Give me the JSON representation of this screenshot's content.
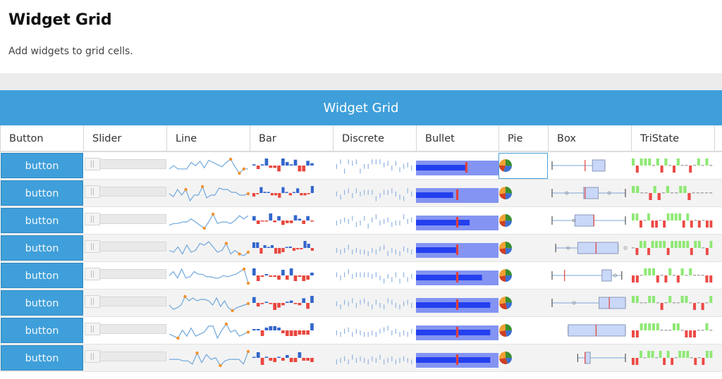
{
  "page": {
    "title": "Widget Grid",
    "subtitle": "Add widgets to grid cells."
  },
  "grid": {
    "title": "Widget Grid",
    "columns": [
      "Button",
      "Slider",
      "Line",
      "Bar",
      "Discrete",
      "Bullet",
      "Pie",
      "Box",
      "TriState"
    ],
    "colors": {
      "header_bg": "#3f9fda",
      "line": "#6fa8dc",
      "line_marker": "#f0922e",
      "bar_pos": "#3366cc",
      "bar_neg": "#e8473e",
      "discrete": "#8fb4e0",
      "bullet_range": "#8494f2",
      "bullet_value": "#2440ee",
      "bullet_target": "#e2403a",
      "pie": [
        "#3a8f2e",
        "#3c6fd4",
        "#cf3f22",
        "#f2a134"
      ],
      "box_fill": "#c9d7f8",
      "box_median": "#e2403a",
      "tristate_pos": "#8ee874",
      "tristate_neg": "#ec4a45",
      "tristate_zero": "#aaaaaa"
    },
    "rows": [
      {
        "button_label": "button",
        "slider_value": 0,
        "line": [
          6,
          9,
          6,
          6,
          6,
          12,
          9,
          13,
          7,
          14,
          12,
          10,
          8,
          12,
          15,
          8,
          2,
          6,
          6
        ],
        "line_markers": [
          14,
          16,
          17
        ],
        "bar": [
          1,
          -3,
          1,
          6,
          -2,
          -2,
          -5,
          6,
          3,
          1,
          5,
          -5,
          -5,
          4,
          2
        ],
        "discrete": [
          6,
          9,
          3,
          9,
          8,
          9,
          3,
          6,
          6,
          9,
          9,
          9,
          7,
          8,
          5,
          8,
          4,
          6,
          7,
          5
        ],
        "bullet": {
          "value": 0.6,
          "target": 0.61
        },
        "pie": [
          0.27,
          0.28,
          0.2,
          0.25
        ],
        "box": {
          "min": 0.0,
          "q1": 0.55,
          "median": 0.45,
          "q3": 0.72,
          "max": 0.72,
          "outliers": []
        },
        "tristate": [
          1,
          -1,
          1,
          1,
          1,
          0,
          1,
          -1,
          1,
          0,
          -1,
          1,
          0,
          0,
          -1,
          0,
          1,
          0,
          1,
          0
        ]
      },
      {
        "button_label": "button",
        "slider_value": 0,
        "line": [
          7,
          5,
          10,
          6,
          10,
          2,
          6,
          6,
          12,
          4,
          6,
          6,
          11,
          10,
          10,
          8,
          8,
          6,
          6,
          7
        ],
        "line_markers": [
          4,
          8,
          19
        ],
        "bar": [
          -3,
          -1,
          5,
          1,
          0,
          -2,
          -2,
          -4,
          5,
          0,
          -2,
          0,
          4,
          -2,
          -2,
          -1,
          6
        ],
        "discrete": [
          6,
          4,
          7,
          8,
          5,
          8,
          6,
          7,
          7,
          7,
          3,
          5,
          7,
          7,
          8,
          6,
          4,
          3,
          8,
          6
        ],
        "bullet": {
          "value": 0.45,
          "target": 0.5
        },
        "pie": [
          0.26,
          0.24,
          0.22,
          0.28
        ],
        "box": {
          "min": 0.0,
          "q1": 0.43,
          "median": 0.45,
          "q3": 0.63,
          "max": 1.0,
          "outliers": [
            0.2,
            0.78
          ]
        },
        "tristate": [
          1,
          1,
          0,
          0,
          -1,
          1,
          -1,
          0,
          1,
          0,
          0,
          1,
          1,
          -1,
          0,
          0,
          0,
          0,
          0
        ]
      },
      {
        "button_label": "button",
        "slider_value": 0,
        "line": [
          3,
          4,
          4,
          5,
          5,
          7,
          5,
          3,
          1,
          5,
          10,
          4,
          5,
          5,
          4,
          6,
          9,
          7,
          9
        ],
        "line_markers": [
          8,
          10,
          19
        ],
        "bar": [
          5,
          -4,
          -1,
          -1,
          8,
          -2,
          5,
          -5,
          -3,
          -3,
          6,
          2,
          -4,
          5,
          -1
        ],
        "discrete": [
          5,
          6,
          7,
          6,
          8,
          4,
          5,
          8,
          3,
          7,
          9,
          5,
          6,
          7,
          4,
          5,
          5,
          9,
          6,
          7
        ],
        "bullet": {
          "value": 0.65,
          "target": 0.5
        },
        "pie": [
          0.26,
          0.26,
          0.2,
          0.28
        ],
        "box": {
          "min": 0.0,
          "q1": 0.31,
          "median": 0.57,
          "q3": 0.57,
          "max": 1.0,
          "outliers": [
            0.3
          ]
        },
        "tristate": [
          1,
          1,
          -1,
          0,
          1,
          -1,
          -1,
          0,
          -1,
          1,
          1,
          1,
          1,
          -1,
          1,
          -1,
          0,
          -1,
          0,
          -1,
          -1
        ]
      },
      {
        "button_label": "button",
        "slider_value": 0,
        "line": [
          5,
          4,
          7,
          3,
          8,
          4,
          5,
          9,
          8,
          10,
          7,
          4,
          5,
          9,
          3,
          5,
          3,
          2,
          4
        ],
        "line_markers": [
          13,
          16,
          18
        ],
        "bar": [
          4,
          4,
          -4,
          2,
          0,
          2,
          -4,
          -4,
          -3,
          0,
          1,
          -2,
          -1,
          -1,
          5,
          3,
          -2
        ],
        "discrete": [
          5,
          4,
          5,
          7,
          4,
          5,
          4,
          4,
          3,
          5,
          4,
          6,
          7,
          3,
          5,
          4,
          3,
          6,
          5,
          4
        ],
        "bullet": {
          "value": 0.5,
          "target": 0.5
        },
        "pie": [
          0.26,
          0.24,
          0.22,
          0.28
        ],
        "box": {
          "min": 0.05,
          "q1": 0.35,
          "median": 0.6,
          "q3": 0.9,
          "max": 0.9,
          "outliers": [
            0.22,
            1.0
          ]
        },
        "tristate": [
          0,
          -1,
          1,
          1,
          -1,
          1,
          1,
          1,
          1,
          -1,
          1,
          1,
          1,
          1,
          1,
          -1,
          1,
          1,
          0,
          -1,
          1
        ]
      },
      {
        "button_label": "button",
        "slider_value": 0,
        "line": [
          8,
          11,
          6,
          13,
          6,
          7,
          11,
          9,
          9,
          7,
          7,
          6,
          6,
          8,
          7,
          8,
          9,
          11,
          13,
          2
        ],
        "line_markers": [
          18,
          19
        ],
        "bar": [
          5,
          -4,
          -1,
          1,
          -1,
          -1,
          -3,
          4,
          -3,
          5,
          -4,
          -1,
          -4,
          -3,
          2
        ],
        "discrete": [
          7,
          5,
          7,
          9,
          6,
          7,
          7,
          7,
          7,
          6,
          7,
          5,
          3,
          6,
          4,
          7,
          3,
          7,
          4,
          6
        ],
        "bullet": {
          "value": 0.8,
          "target": 0.5
        },
        "pie": [
          0.25,
          0.25,
          0.22,
          0.28
        ],
        "box": {
          "min": 0.0,
          "q1": 0.68,
          "median": 0.17,
          "q3": 0.81,
          "max": 0.95,
          "outliers": [
            0.86
          ]
        },
        "tristate": [
          -1,
          -1,
          0,
          1,
          1,
          1,
          -1,
          0,
          -1,
          1,
          0,
          -1,
          1,
          0,
          1,
          0,
          0,
          0,
          -1,
          -1
        ]
      },
      {
        "button_label": "button",
        "slider_value": 0,
        "line": [
          5,
          2,
          3,
          5,
          11,
          8,
          10,
          8,
          9,
          9,
          8,
          5,
          10,
          4,
          8,
          3,
          1,
          3,
          4,
          5,
          6
        ],
        "line_markers": [
          4,
          16,
          20
        ],
        "bar": [
          5,
          -3,
          -1,
          1,
          -1,
          -6,
          -4,
          -2,
          1,
          2,
          -1,
          -2,
          4,
          -5,
          6
        ],
        "discrete": [
          6,
          4,
          7,
          6,
          8,
          5,
          7,
          8,
          6,
          4,
          7,
          5,
          4,
          8,
          7,
          5,
          4,
          6,
          7,
          5
        ],
        "bullet": {
          "value": 0.9,
          "target": 0.5
        },
        "pie": [
          0.24,
          0.22,
          0.26,
          0.28
        ],
        "box": {
          "min": 0.0,
          "q1": 0.64,
          "median": 0.78,
          "q3": 1.0,
          "max": 1.0,
          "outliers": [
            0.3
          ]
        },
        "tristate": [
          1,
          1,
          0,
          0,
          1,
          1,
          0,
          -1,
          0,
          1,
          0,
          0,
          1,
          1,
          0,
          -1,
          0,
          -1,
          0,
          1
        ]
      },
      {
        "button_label": "button",
        "slider_value": 0,
        "line": [
          4,
          3,
          2,
          6,
          3,
          7,
          3,
          4,
          5,
          8,
          8,
          2,
          6,
          9,
          5,
          6,
          3,
          4,
          5
        ],
        "line_markers": [
          2,
          13,
          18
        ],
        "bar": [
          1,
          1,
          -4,
          2,
          3,
          3,
          2,
          -2,
          -4,
          -4,
          -4,
          -3,
          -3,
          -3,
          5
        ],
        "discrete": [
          5,
          4,
          6,
          7,
          4,
          6,
          5,
          4,
          4,
          5,
          4,
          6,
          7,
          8,
          5,
          6,
          4,
          5,
          4,
          6
        ],
        "bullet": {
          "value": 0.9,
          "target": 0.5
        },
        "pie": [
          0.25,
          0.23,
          0.24,
          0.28
        ],
        "box": {
          "min": 0.22,
          "q1": 0.22,
          "median": 0.6,
          "q3": 1.0,
          "max": 1.0,
          "outliers": []
        },
        "tristate": [
          -1,
          -1,
          1,
          1,
          1,
          1,
          1,
          0,
          0,
          0,
          1,
          1,
          0,
          -1,
          -1,
          -1,
          0,
          0,
          1,
          0
        ]
      },
      {
        "button_label": "button",
        "slider_value": 0,
        "line": [
          5,
          5,
          5,
          4,
          4,
          2,
          9,
          3,
          8,
          5,
          6,
          1,
          4,
          5,
          5,
          5,
          2,
          10
        ],
        "line_markers": [
          6,
          11,
          17
        ],
        "bar": [
          0,
          4,
          -5,
          0,
          -2,
          -3,
          0,
          -2,
          2,
          -3,
          -3,
          4,
          -2,
          -2,
          -3
        ],
        "discrete": [
          4,
          5,
          6,
          4,
          7,
          5,
          6,
          5,
          4,
          6,
          5,
          7,
          4,
          5,
          6,
          4,
          5,
          6,
          5,
          4
        ],
        "bullet": {
          "value": 0.9,
          "target": 0.5
        },
        "pie": [
          0.25,
          0.2,
          0.27,
          0.28
        ],
        "box": {
          "min": 0.35,
          "q1": 0.45,
          "median": 0.45,
          "q3": 0.52,
          "max": 1.0,
          "outliers": [],
          "target": 0.0
        },
        "tristate": [
          -1,
          -1,
          1,
          0,
          1,
          1,
          0,
          1,
          -1,
          1,
          -1,
          0,
          1,
          1,
          1,
          0,
          -1,
          0,
          -1,
          1,
          1
        ]
      }
    ]
  }
}
